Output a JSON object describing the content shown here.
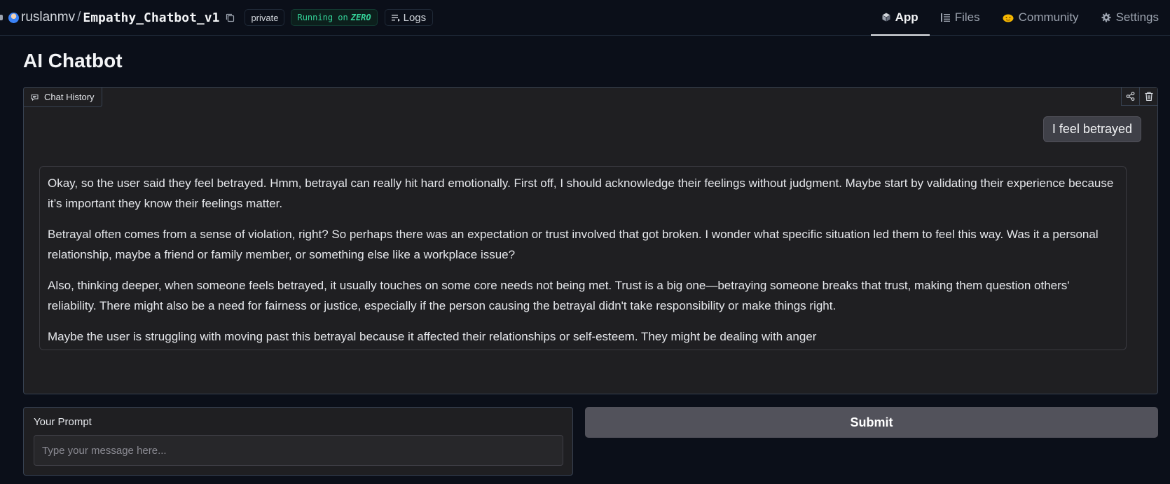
{
  "header": {
    "owner": "ruslanmv",
    "separator": "/",
    "repo": "Empathy_Chatbot_v1",
    "visibility": "private",
    "status_prefix": "Running on",
    "status_hardware": "ZERO",
    "logs_label": "Logs",
    "nav": [
      {
        "label": "App",
        "icon": "cube-icon",
        "active": true
      },
      {
        "label": "Files",
        "icon": "files-icon",
        "active": false
      },
      {
        "label": "Community",
        "icon": "community-icon",
        "active": false
      },
      {
        "label": "Settings",
        "icon": "gear-icon",
        "active": false
      }
    ]
  },
  "app": {
    "title": "AI Chatbot",
    "chatbot": {
      "label": "Chat History",
      "messages": [
        {
          "role": "user",
          "text": "I feel betrayed"
        },
        {
          "role": "assistant",
          "paragraphs": [
            "Okay, so the user said they feel betrayed. Hmm, betrayal can really hit hard emotionally. First off, I should acknowledge their feelings without judgment. Maybe start by validating their experience because it’s important they know their feelings matter.",
            "Betrayal often comes from a sense of violation, right? So perhaps there was an expectation or trust involved that got broken. I wonder what specific situation led them to feel this way. Was it a personal relationship, maybe a friend or family member, or something else like a workplace issue?",
            "Also, thinking deeper, when someone feels betrayed, it usually touches on some core needs not being met. Trust is a big one—betraying someone breaks that trust, making them question others' reliability. There might also be a need for fairness or justice, especially if the person causing the betrayal didn't take responsibility or make things right.",
            "Maybe the user is struggling with moving past this betrayal because it affected their relationships or self-esteem. They might be dealing with anger"
          ]
        }
      ]
    },
    "prompt": {
      "label": "Your Prompt",
      "value": "",
      "placeholder": "Type your message here..."
    },
    "submit_label": "Submit"
  },
  "colors": {
    "background": "#0b0f19",
    "panel": "#1f1f22",
    "running_green": "#34d399",
    "submit": "#52525b"
  }
}
